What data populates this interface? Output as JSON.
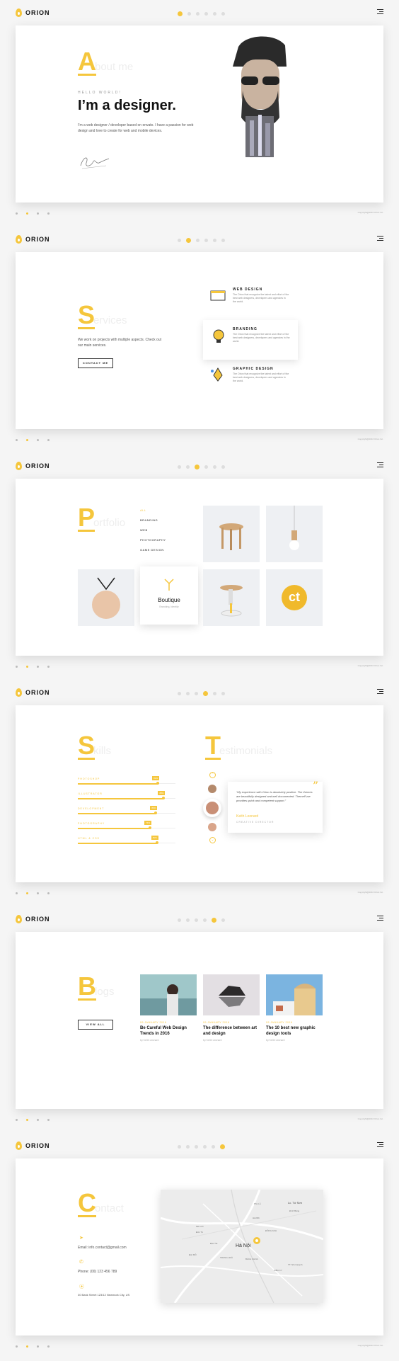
{
  "logo": {
    "text": "ORION"
  },
  "copyright": "Copyright@2016 Orion Inc.",
  "about": {
    "letter": "A",
    "rest": "bout me",
    "greeting": "HELLO WORLD!",
    "headline": "I’m a designer.",
    "intro": "I’m a web designer / developer based on envato. I have a passion for web design and love to create for web and mobile devices."
  },
  "services": {
    "letter": "S",
    "rest": "ervices",
    "intro": "We work on projects with multiple aspects. Check out our main services.",
    "button": "CONTACT ME",
    "items": [
      {
        "title": "WEB DESIGN",
        "desc": "The Orion that recognize the talent and effort of the best web designers, developers and agencies in the world."
      },
      {
        "title": "BRANDING",
        "desc": "The Orion that recognize the talent and effort of the best web designers, developers and agencies in the world."
      },
      {
        "title": "GRAPHIC DESIGN",
        "desc": "The Orion that recognize the talent and effort of the best web designers, developers and agencies in the world."
      }
    ]
  },
  "portfolio": {
    "letter": "P",
    "rest": "ortfolio",
    "filters": [
      "ALL",
      "BRANDING",
      "WEB",
      "PHOTOGRAPHY",
      "GAME DESIGN"
    ],
    "featured_title": "Boutique",
    "featured_sub": "Branding, Identity",
    "tile_text": "ct"
  },
  "skills": {
    "letter": "S",
    "rest": "kills",
    "items": [
      {
        "name": "PHOTOSHOP",
        "value": 82,
        "badge": "82%"
      },
      {
        "name": "ILLUSTRATOR",
        "value": 88,
        "badge": "88%"
      },
      {
        "name": "DEVELOPMENT",
        "value": 80,
        "badge": "80%"
      },
      {
        "name": "PHOTOGRAPHY",
        "value": 74,
        "badge": "74%"
      },
      {
        "name": "HTML & CSS",
        "value": 81,
        "badge": "81%"
      }
    ]
  },
  "testimonials": {
    "letter": "T",
    "rest": "estimonials",
    "quote": "“My experience with Orion is absolutely positive. The themes are beautifully designed and well documented. ThemeFuse provides quick and competent support.”",
    "author": "Keith Leonard",
    "role": "CREATIVE DIRECTOR"
  },
  "blogs": {
    "letter": "B",
    "rest": "logs",
    "button": "VIEW ALL",
    "posts": [
      {
        "date": "09 JANUARY 2016",
        "title": "Be Careful Web Design Trends in 2016",
        "author": "by Keith Leonard"
      },
      {
        "date": "09 JANUARY 2016",
        "title": "The difference between art and design",
        "author": "by Keith Leonard"
      },
      {
        "date": "09 JANUARY 2016",
        "title": "The 10 best new graphic design tools",
        "author": "by Keith Leonard"
      }
    ]
  },
  "contact": {
    "letter": "C",
    "rest": "ontact",
    "email": "Email: info.contact@gmail.com",
    "phone": "Phone: (00) 123 456 789",
    "address": "30 Bank Street 123/12 Newmork City, US",
    "map_city": "Hà Nội",
    "map_labels": [
      "Lc. Tứ Sơn",
      "Đình Bảng",
      "Hải Bối",
      "Mê Linh",
      "Phù Lỗ",
      "Đặc Tài",
      "Đức Tú",
      "ĐẠI MỖ",
      "ĐÔNG ANH",
      "TRUNG HOÀ",
      "BÁCH KHOA",
      "TT. Như Quỳnh",
      "KIÊU KY"
    ]
  }
}
